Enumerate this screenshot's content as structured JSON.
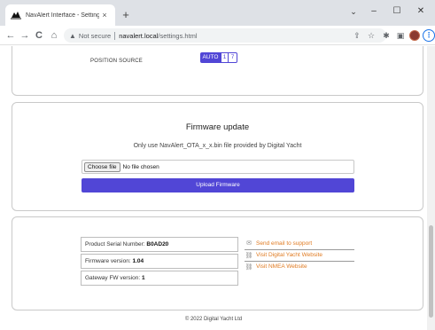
{
  "browser": {
    "tab_title": "NavAlert Interface - Settings",
    "tab_close": "×",
    "new_tab": "+",
    "window_minimize": "–",
    "window_maximize": "☐",
    "window_close": "✕",
    "back": "←",
    "forward": "→",
    "reload": "C",
    "home": "⌂",
    "security_label": "Not secure",
    "url_host": "navalert.local",
    "url_path": "/settings.html",
    "icons": [
      "share-icon",
      "star-icon",
      "extensions-icon",
      "sidepanel-icon",
      "profile-avatar",
      "menu-icon"
    ]
  },
  "position_source": {
    "label": "POSITION SOURCE",
    "options": [
      "AUTO",
      "1",
      "7"
    ],
    "selected": "AUTO"
  },
  "firmware": {
    "title": "Firmware update",
    "subtitle": "Only use NavAlert_OTA_x_x.bin file provided by Digital Yacht",
    "choose_file": "Choose file",
    "no_file": "No file chosen",
    "upload": "Upload Firmware"
  },
  "info": {
    "serial_label": "Product Serial Number:",
    "serial_value": "B0AD20",
    "firmware_label": "Firmware version:",
    "firmware_value": "1.04",
    "gateway_label": "Gateway FW version:",
    "gateway_value": "1"
  },
  "links": {
    "email": "Send email to support",
    "website": "Visit Digital Yacht Website",
    "nmea": "Visit NMEA Website"
  },
  "footer": "© 2022 Digital Yacht Ltd",
  "colors": {
    "accent": "#5146d6",
    "link": "#e07b22"
  }
}
